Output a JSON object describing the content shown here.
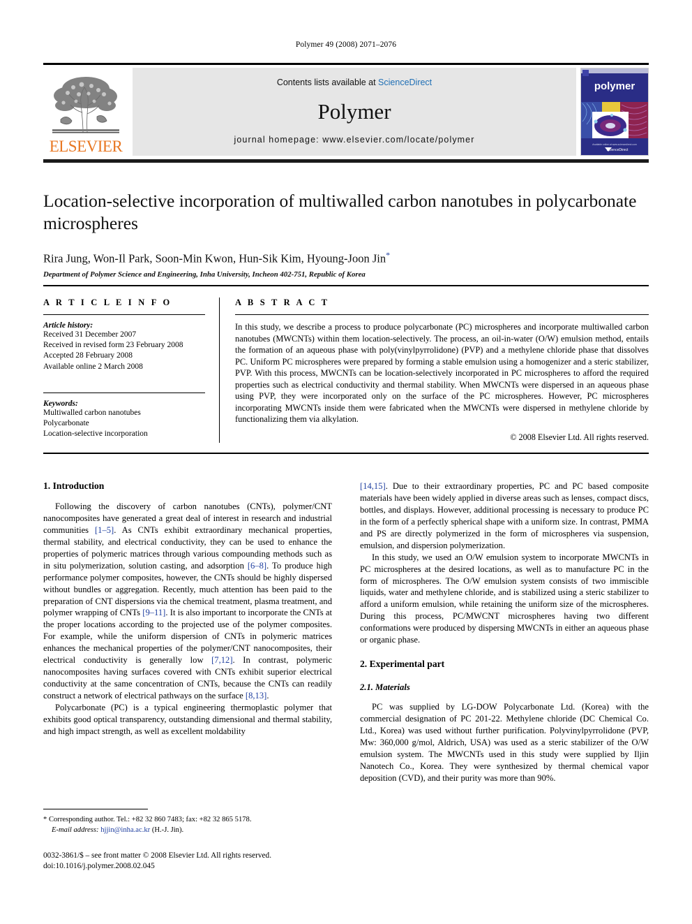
{
  "running_head": "Polymer 49 (2008) 2071–2076",
  "banner": {
    "publisher": "ELSEVIER",
    "contents_prefix": "Contents lists available at ",
    "contents_link": "ScienceDirect",
    "journal_name": "Polymer",
    "homepage": "journal homepage: www.elsevier.com/locate/polymer",
    "cover_title": "polymer",
    "cover_footer": "ScienceDirect",
    "accent_orange": "#E87722",
    "link_blue": "#1f6fb5",
    "cover_blue": "#2a2d86"
  },
  "title": "Location-selective incorporation of multiwalled carbon nanotubes in polycarbonate microspheres",
  "authors": "Rira Jung, Won-Il Park, Soon-Min Kwon, Hun-Sik Kim, Hyoung-Joon Jin",
  "author_marker": "*",
  "affiliation": "Department of Polymer Science and Engineering, Inha University, Incheon 402-751, Republic of Korea",
  "article_info": {
    "heading": "A R T I C L E  I N F O",
    "history_label": "Article history:",
    "history": [
      "Received 31 December 2007",
      "Received in revised form 23 February 2008",
      "Accepted 28 February 2008",
      "Available online 2 March 2008"
    ],
    "keywords_label": "Keywords:",
    "keywords": [
      "Multiwalled carbon nanotubes",
      "Polycarbonate",
      "Location-selective incorporation"
    ]
  },
  "abstract": {
    "heading": "A B S T R A C T",
    "text": "In this study, we describe a process to produce polycarbonate (PC) microspheres and incorporate multiwalled carbon nanotubes (MWCNTs) within them location-selectively. The process, an oil-in-water (O/W) emulsion method, entails the formation of an aqueous phase with poly(vinylpyrrolidone) (PVP) and a methylene chloride phase that dissolves PC. Uniform PC microspheres were prepared by forming a stable emulsion using a homogenizer and a steric stabilizer, PVP. With this process, MWCNTs can be location-selectively incorporated in PC microspheres to afford the required properties such as electrical conductivity and thermal stability. When MWCNTs were dispersed in an aqueous phase using PVP, they were incorporated only on the surface of the PC microspheres. However, PC microspheres incorporating MWCNTs inside them were fabricated when the MWCNTs were dispersed in methylene chloride by functionalizing them via alkylation.",
    "copyright": "© 2008 Elsevier Ltd. All rights reserved."
  },
  "sections": {
    "introduction_heading": "1. Introduction",
    "experimental_heading": "2. Experimental part",
    "materials_heading": "2.1. Materials"
  },
  "paragraphs": {
    "intro_p1_a": "Following the discovery of carbon nanotubes (CNTs), polymer/CNT nanocomposites have generated a great deal of interest in research and industrial communities ",
    "intro_p1_cite1": "[1–5]",
    "intro_p1_b": ". As CNTs exhibit extraordinary mechanical properties, thermal stability, and electrical conductivity, they can be used to enhance the properties of polymeric matrices through various compounding methods such as in situ polymerization, solution casting, and adsorption ",
    "intro_p1_cite2": "[6–8]",
    "intro_p1_c": ". To produce high performance polymer composites, however, the CNTs should be highly dispersed without bundles or aggregation. Recently, much attention has been paid to the preparation of CNT dispersions via the chemical treatment, plasma treatment, and polymer wrapping of CNTs ",
    "intro_p1_cite3": "[9–11]",
    "intro_p1_d": ". It is also important to incorporate the CNTs at the proper locations according to the projected use of the polymer composites. For example, while the uniform dispersion of CNTs in polymeric matrices enhances the mechanical properties of the polymer/CNT nanocomposites, their electrical conductivity is generally low ",
    "intro_p1_cite4": "[7,12]",
    "intro_p1_e": ". In contrast, polymeric nanocomposites having surfaces covered with CNTs exhibit superior electrical conductivity at the same concentration of CNTs, because the CNTs can readily construct a network of electrical pathways on the surface ",
    "intro_p1_cite5": "[8,13]",
    "intro_p1_f": ".",
    "intro_p2_a": "Polycarbonate (PC) is a typical engineering thermoplastic polymer that exhibits good optical transparency, outstanding dimensional and thermal stability, and high impact strength, as well as excellent moldability ",
    "intro_p2_cite1": "[14,15]",
    "intro_p2_b": ". Due to their extraordinary properties, PC and PC based composite materials have been widely applied in diverse areas such as lenses, compact discs, bottles, and displays. However, additional processing is necessary to produce PC in the form of a perfectly spherical shape with a uniform size. In contrast, PMMA and PS are directly polymerized in the form of microspheres via suspension, emulsion, and dispersion polymerization.",
    "intro_p3": "In this study, we used an O/W emulsion system to incorporate MWCNTs in PC microspheres at the desired locations, as well as to manufacture PC in the form of microspheres. The O/W emulsion system consists of two immiscible liquids, water and methylene chloride, and is stabilized using a steric stabilizer to afford a uniform emulsion, while retaining the uniform size of the microspheres. During this process, PC/MWCNT microspheres having two different conformations were produced by dispersing MWCNTs in either an aqueous phase or organic phase.",
    "materials_p1": "PC was supplied by LG-DOW Polycarbonate Ltd. (Korea) with the commercial designation of PC 201-22. Methylene chloride (DC Chemical Co. Ltd., Korea) was used without further purification. Polyvinylpyrrolidone (PVP, Mw: 360,000 g/mol, Aldrich, USA) was used as a steric stabilizer of the O/W emulsion system. The MWCNTs used in this study were supplied by Iljin Nanotech Co., Korea. They were synthesized by thermal chemical vapor deposition (CVD), and their purity was more than 90%."
  },
  "footnotes": {
    "corresponding_marker": "*",
    "corresponding": " Corresponding author. Tel.: +82 32 860 7483; fax: +82 32 865 5178.",
    "email_label": "E-mail address:",
    "email": "hjjin@inha.ac.kr",
    "email_suffix": " (H.-J. Jin)."
  },
  "imprint": {
    "line1": "0032-3861/$ – see front matter © 2008 Elsevier Ltd. All rights reserved.",
    "line2": "doi:10.1016/j.polymer.2008.02.045"
  }
}
